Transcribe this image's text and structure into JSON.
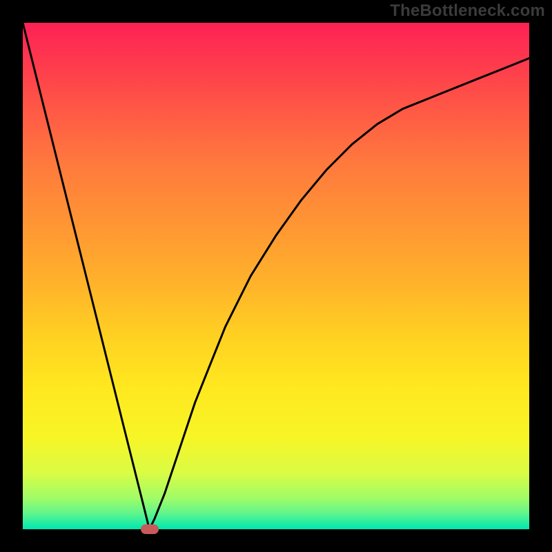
{
  "watermark": "TheBottleneck.com",
  "chart_data": {
    "type": "line",
    "title": "",
    "xlabel": "",
    "ylabel": "",
    "xlim": [
      0,
      1
    ],
    "ylim": [
      0,
      1
    ],
    "x": [
      0.0,
      0.05,
      0.1,
      0.15,
      0.2,
      0.22,
      0.24,
      0.25,
      0.26,
      0.28,
      0.3,
      0.32,
      0.34,
      0.36,
      0.38,
      0.4,
      0.45,
      0.5,
      0.55,
      0.6,
      0.65,
      0.7,
      0.75,
      0.8,
      0.85,
      0.9,
      0.95,
      1.0
    ],
    "values": [
      1.0,
      0.8,
      0.6,
      0.4,
      0.2,
      0.12,
      0.04,
      0.0,
      0.02,
      0.07,
      0.13,
      0.19,
      0.25,
      0.3,
      0.35,
      0.4,
      0.5,
      0.58,
      0.65,
      0.71,
      0.76,
      0.8,
      0.83,
      0.85,
      0.87,
      0.89,
      0.91,
      0.93
    ],
    "marker": {
      "x": 0.25,
      "y": 0.0,
      "color": "#c75a5a"
    },
    "background_gradient": {
      "direction": "top-to-bottom",
      "stops": [
        {
          "pos": 0.0,
          "color": "#fd2155"
        },
        {
          "pos": 0.18,
          "color": "#ff5b45"
        },
        {
          "pos": 0.4,
          "color": "#ff9633"
        },
        {
          "pos": 0.62,
          "color": "#ffd122"
        },
        {
          "pos": 0.82,
          "color": "#f7f526"
        },
        {
          "pos": 1.0,
          "color": "#00e6b0"
        }
      ]
    }
  }
}
